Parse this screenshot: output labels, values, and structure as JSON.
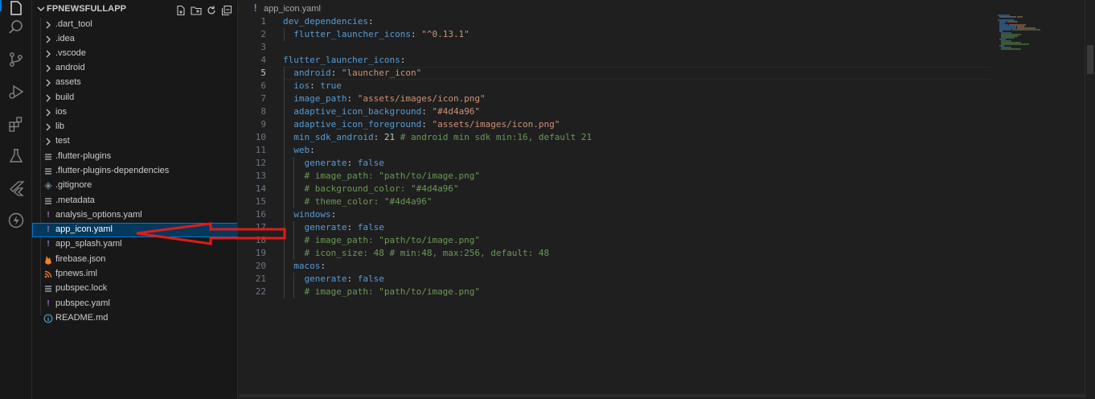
{
  "explorer": {
    "title": "FPNEWSFULLAPP",
    "items": [
      {
        "label": ".dart_tool",
        "kind": "folder"
      },
      {
        "label": ".idea",
        "kind": "folder"
      },
      {
        "label": ".vscode",
        "kind": "folder"
      },
      {
        "label": "android",
        "kind": "folder"
      },
      {
        "label": "assets",
        "kind": "folder"
      },
      {
        "label": "build",
        "kind": "folder"
      },
      {
        "label": "ios",
        "kind": "folder"
      },
      {
        "label": "lib",
        "kind": "folder"
      },
      {
        "label": "test",
        "kind": "folder"
      },
      {
        "label": ".flutter-plugins",
        "kind": "lines-file"
      },
      {
        "label": ".flutter-plugins-dependencies",
        "kind": "lines-file"
      },
      {
        "label": ".gitignore",
        "kind": "git-file"
      },
      {
        "label": ".metadata",
        "kind": "lines-file"
      },
      {
        "label": "analysis_options.yaml",
        "kind": "yaml-file"
      },
      {
        "label": "app_icon.yaml",
        "kind": "yaml-file"
      },
      {
        "label": "app_splash.yaml",
        "kind": "yaml-file"
      },
      {
        "label": "firebase.json",
        "kind": "firebase-file"
      },
      {
        "label": "fpnews.iml",
        "kind": "rss-file"
      },
      {
        "label": "pubspec.lock",
        "kind": "lines-file"
      },
      {
        "label": "pubspec.yaml",
        "kind": "yaml-file"
      },
      {
        "label": "README.md",
        "kind": "info-file"
      }
    ],
    "selected": "app_icon.yaml"
  },
  "editor": {
    "file_name": "app_icon.yaml",
    "file_icon": "!",
    "current_line": "5",
    "lines": [
      {
        "n": "1",
        "text": "dev_dependencies:"
      },
      {
        "n": "2",
        "text": "  flutter_launcher_icons: \"^0.13.1\""
      },
      {
        "n": "3",
        "text": ""
      },
      {
        "n": "4",
        "text": "flutter_launcher_icons:"
      },
      {
        "n": "5",
        "text": "  android: \"launcher_icon\""
      },
      {
        "n": "6",
        "text": "  ios: true"
      },
      {
        "n": "7",
        "text": "  image_path: \"assets/images/icon.png\""
      },
      {
        "n": "8",
        "text": "  adaptive_icon_background: \"#4d4a96\""
      },
      {
        "n": "9",
        "text": "  adaptive_icon_foreground: \"assets/images/icon.png\""
      },
      {
        "n": "10",
        "text": "  min_sdk_android: 21 # android min sdk min:16, default 21"
      },
      {
        "n": "11",
        "text": "  web:"
      },
      {
        "n": "12",
        "text": "    generate: false"
      },
      {
        "n": "13",
        "text": "    # image_path: \"path/to/image.png\""
      },
      {
        "n": "14",
        "text": "    # background_color: \"#4d4a96\""
      },
      {
        "n": "15",
        "text": "    # theme_color: \"#4d4a96\""
      },
      {
        "n": "16",
        "text": "  windows:"
      },
      {
        "n": "17",
        "text": "    generate: false"
      },
      {
        "n": "18",
        "text": "    # image_path: \"path/to/image.png\""
      },
      {
        "n": "19",
        "text": "    # icon_size: 48 # min:48, max:256, default: 48"
      },
      {
        "n": "20",
        "text": "  macos:"
      },
      {
        "n": "21",
        "text": "    generate: false"
      },
      {
        "n": "22",
        "text": "    # image_path: \"path/to/image.png\""
      }
    ]
  },
  "activity_bar": {
    "icons": [
      "explorer-icon",
      "search-icon",
      "source-control-icon",
      "run-debug-icon",
      "extensions-icon",
      "testing-icon",
      "flutter-icon",
      "lightning-icon"
    ]
  },
  "annotation": {
    "arrow_color": "#e01b1b"
  },
  "colors": {
    "selection": "#04395e",
    "accent": "#0078d4",
    "key": "#569cd6",
    "string": "#ce9178",
    "comment": "#6a9955",
    "number": "#b5cea8"
  }
}
